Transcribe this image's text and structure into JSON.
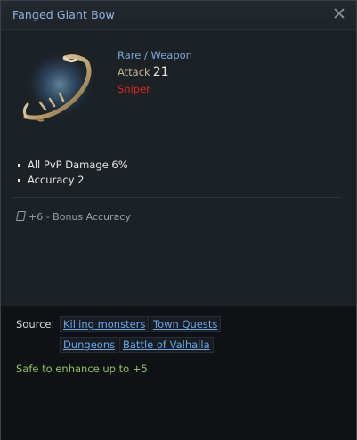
{
  "item": {
    "name": "Fanged Giant Bow",
    "grade": "Rare / Weapon",
    "attack_label": "Attack",
    "attack_value": "21",
    "class": "Sniper",
    "icon": "bow-icon"
  },
  "stats": [
    "All PvP Damage 6%",
    "Accuracy 2"
  ],
  "bonus": {
    "icon": "rune-icon",
    "text": "+6 - Bonus Accuracy"
  },
  "source": {
    "label": "Source:",
    "tags": [
      "Killing monsters",
      "Town Quests",
      "Dungeons",
      "Battle of Valhalla"
    ]
  },
  "enhance_note": "Safe to enhance up to +5",
  "colors": {
    "title": "#8fb3e0",
    "grade": "#7aa6dc",
    "class": "#e0281d",
    "enhance": "#8fc15c",
    "link": "#6aa8e4"
  }
}
